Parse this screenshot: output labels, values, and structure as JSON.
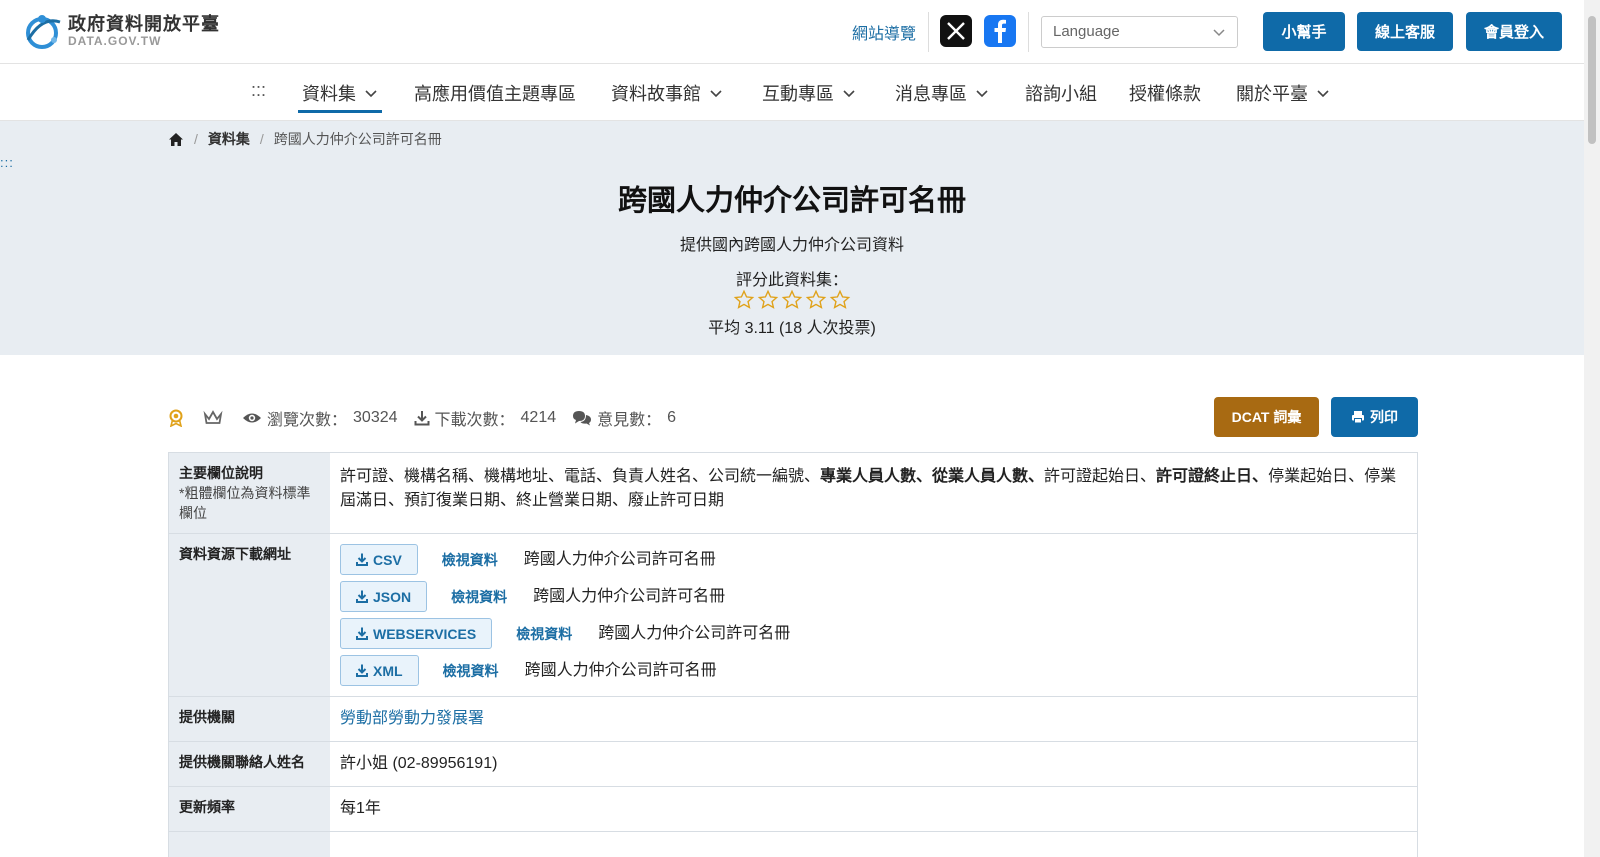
{
  "header": {
    "logo_title": "政府資料開放平臺",
    "logo_sub": "DATA.GOV.TW",
    "sitemap": "網站導覽",
    "language_placeholder": "Language",
    "buttons": {
      "helper": "小幫手",
      "support": "線上客服",
      "login": "會員登入"
    }
  },
  "nav": {
    "menu_marker": ":::",
    "items": [
      {
        "label": "資料集",
        "dropdown": true,
        "active": true
      },
      {
        "label": "高應用價值主題專區",
        "dropdown": false
      },
      {
        "label": "資料故事館",
        "dropdown": true
      },
      {
        "label": "互動專區",
        "dropdown": true
      },
      {
        "label": "消息專區",
        "dropdown": true
      },
      {
        "label": "諮詢小組",
        "dropdown": false
      },
      {
        "label": "授權條款",
        "dropdown": false
      },
      {
        "label": "關於平臺",
        "dropdown": true
      }
    ]
  },
  "breadcrumb": {
    "section": "資料集",
    "current": "跨國人力仲介公司許可名冊"
  },
  "side_marker": ":::",
  "dataset": {
    "title": "跨國人力仲介公司許可名冊",
    "description": "提供國內跨國人力仲介公司資料",
    "rate_label": "評分此資料集：",
    "rating_stars": 5,
    "rating_average": "平均 3.11 (18 人次投票)"
  },
  "stats": {
    "views_label": "瀏覽次數：",
    "views": "30324",
    "downloads_label": "下載次數：",
    "downloads": "4214",
    "comments_label": "意見數：",
    "comments": "6"
  },
  "actions": {
    "dcat": "DCAT 詞彙",
    "print": "列印"
  },
  "info": {
    "fields_label": "主要欄位說明",
    "fields_note": "*粗體欄位為資料標準欄位",
    "fields_part1": "許可證、機構名稱、機構地址、電話、負責人姓名、公司統一編號、",
    "fields_bold1": "專業人員人數、從業人員人數、",
    "fields_part2": "許可證起始日、",
    "fields_bold2": "許可證終止日、",
    "fields_part3": "停業起始日、停業屆滿日、預訂復業日期、終止營業日期、廢止許可日期",
    "resources_label": "資料資源下載網址",
    "view_label": "檢視資料",
    "resources": [
      {
        "format": "CSV",
        "name": "跨國人力仲介公司許可名冊"
      },
      {
        "format": "JSON",
        "name": "跨國人力仲介公司許可名冊"
      },
      {
        "format": "WEBSERVICES",
        "name": "跨國人力仲介公司許可名冊"
      },
      {
        "format": "XML",
        "name": "跨國人力仲介公司許可名冊"
      }
    ],
    "org_label": "提供機關",
    "org": "勞動部勞動力發展署",
    "contact_label": "提供機關聯絡人姓名",
    "contact": "許小姐 (02-89956191)",
    "freq_label": "更新頻率",
    "freq": "每1年"
  }
}
